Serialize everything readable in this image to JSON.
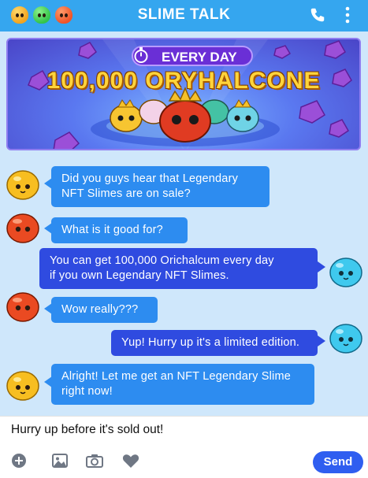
{
  "header": {
    "title": "SLIME TALK",
    "slime_colors": [
      "#f2a41d",
      "#34c44a",
      "#ef5428"
    ],
    "icons": [
      "phone-icon",
      "more-vertical-icon"
    ]
  },
  "banner": {
    "pill_text": "EVERY DAY",
    "headline": "100,000 ORYHALCONE",
    "icons": [
      "stopwatch-icon"
    ]
  },
  "messages": [
    {
      "side": "left",
      "avatar": "yellow-slime",
      "style": "blue",
      "text_lines": [
        "Did you guys hear that Legendary",
        "NFT Slimes are on sale?"
      ]
    },
    {
      "side": "left",
      "avatar": "red-slime",
      "style": "blue",
      "text_lines": [
        "What is it good for?"
      ]
    },
    {
      "side": "right",
      "avatar": "cyan-slime",
      "style": "navy",
      "text_lines": [
        "You can get 100,000 Orichalcum every day",
        "if you own Legendary NFT Slimes."
      ]
    },
    {
      "side": "left",
      "avatar": "red-slime",
      "style": "blue",
      "text_lines": [
        "Wow really???"
      ]
    },
    {
      "side": "right",
      "avatar": "cyan-slime",
      "style": "navy",
      "text_lines": [
        "Yup! Hurry up it's a limited edition."
      ]
    },
    {
      "side": "left",
      "avatar": "yellow-slime",
      "style": "blue",
      "text_lines": [
        "Alright! Let me get an NFT Legendary Slime",
        "right now!"
      ]
    }
  ],
  "composer": {
    "value": "Hurry up before it's sold out!",
    "tools": [
      "add-icon",
      "image-icon",
      "camera-icon",
      "heart-icon"
    ],
    "send_label": "Send"
  },
  "colors": {
    "header": "#35a6ef",
    "background": "#cfe7fb",
    "bubble_blue": "#2d8cf0",
    "bubble_navy": "#2f4be0",
    "send": "#2f5ef0"
  }
}
